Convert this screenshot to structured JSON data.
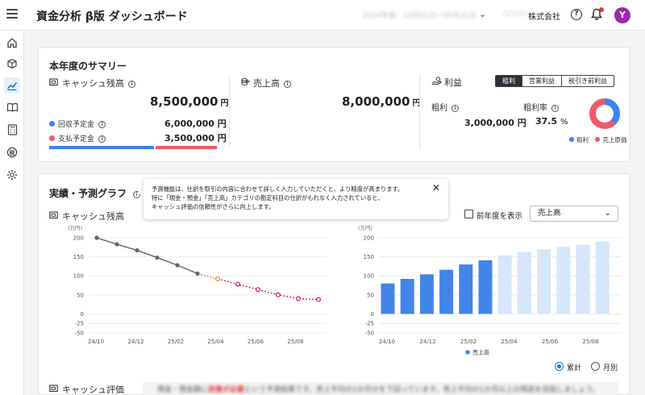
{
  "header": {
    "title": "資金分析 β版 ダッシュボード",
    "period_blurred": "2024年度：10月01日〜05月31日",
    "company_blurred": "○○○○",
    "company": "株式会社",
    "avatar_letter": "Y"
  },
  "sidebar": {
    "items": [
      "home-icon",
      "box-icon",
      "chart-line-icon",
      "book-icon",
      "calculator-icon",
      "tax-icon",
      "gear-icon"
    ],
    "active": "chart-line-icon"
  },
  "summary": {
    "title": "本年度のサマリー",
    "cash": {
      "label": "キャッシュ残高",
      "value": "8,500,000",
      "unit": "円",
      "receivable_label": "回収予定金",
      "receivable_value": "6,000,000 円",
      "payable_label": "支払予定金",
      "payable_value": "3,500,000 円",
      "receivable_ratio": 0.632
    },
    "sales": {
      "label": "売上高",
      "value": "8,000,000",
      "unit": "円"
    },
    "profit": {
      "label": "利益",
      "tabs": [
        "粗利",
        "営業利益",
        "税引き前利益"
      ],
      "gross_label": "粗利",
      "gross_value": "3,000,000 円",
      "rate_label": "粗利率",
      "rate_value": "37.5",
      "rate_unit": "%",
      "legend": [
        "粗利",
        "売上原価"
      ],
      "donut_fraction": 0.375
    }
  },
  "forecast": {
    "title": "実績・予測グラフ",
    "tooltip_line1": "予測機能は、仕訳を取引の内容に合わせて詳しく入力していただくと、より精度が高まります。",
    "tooltip_line2": "特に「現金・預金」「売上高」カテゴリの勘定科目の仕訳がもれなく入力されていると、",
    "tooltip_line3": "キャッシュ評価の信頼性がさらに向上します。",
    "cash_label": "キャッシュ残高",
    "prev_year_label": "前年度を表示",
    "select_value": "売上高",
    "radio_cumulative": "累計",
    "radio_monthly": "月別",
    "eval_label": "キャッシュ評価",
    "eval_text_blurred_pre": "現金・預金額に",
    "eval_text_blurred_red": "改善が必要",
    "eval_text_blurred_post": "という予測結果です。売上平均の1か月分を下回っています。売上平均の1か月以上の残高を目指しましょう。"
  },
  "colors": {
    "accent": "#1976d2",
    "receivable": "#3b82f6",
    "payable": "#f05a6a",
    "bar_actual": "#4285e8",
    "bar_forecast": "#d6e6fb",
    "line_actual": "#5a6670",
    "line_forecast": "#d6173d",
    "line_transition": "#f07d1e"
  },
  "chart_data": [
    {
      "type": "line",
      "unit_label": "(万円)",
      "x_ticks": [
        "24/10",
        "24/12",
        "25/02",
        "25/04",
        "25/06",
        "25/08"
      ],
      "y_ticks": [
        200,
        150,
        100,
        50,
        0,
        -25,
        -50
      ],
      "ylim": [
        -50,
        200
      ],
      "series": [
        {
          "values": [
            200,
            183,
            167,
            148,
            128,
            106
          ]
        },
        {
          "values": [
            106,
            92,
            78,
            64,
            50,
            40,
            38
          ]
        }
      ]
    },
    {
      "type": "bar",
      "unit_label": "(万円)",
      "x_ticks": [
        "24/10",
        "24/12",
        "25/02",
        "25/04",
        "25/06",
        "25/08"
      ],
      "y_ticks": [
        200,
        150,
        100,
        50,
        0,
        -25,
        -50
      ],
      "ylim": [
        -50,
        200
      ],
      "series": [
        {
          "name": "売上高",
          "values": [
            80,
            92,
            104,
            116,
            130,
            141
          ]
        },
        {
          "values": [
            154,
            163,
            170,
            176,
            182,
            190
          ]
        }
      ]
    }
  ]
}
